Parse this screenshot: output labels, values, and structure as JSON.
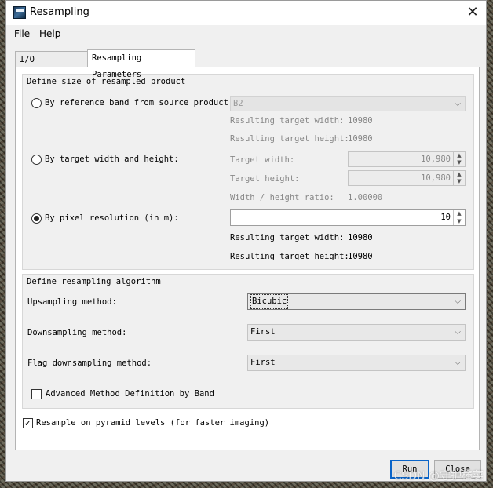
{
  "window": {
    "title": "Resampling"
  },
  "menu": [
    "File",
    "Help"
  ],
  "tabs": [
    "I/O Parameters",
    "Resampling Parameters"
  ],
  "size_group": {
    "title": "Define size of resampled product",
    "by_reference": {
      "label": "By reference band from source product:",
      "value": "B2",
      "result_width_label": "Resulting target width:",
      "result_width": "10980",
      "result_height_label": "Resulting target height:",
      "result_height": "10980"
    },
    "by_target": {
      "label": "By target width and height:",
      "width_label": "Target width:",
      "width": "10,980",
      "height_label": "Target height:",
      "height": "10,980",
      "ratio_label": "Width / height ratio:",
      "ratio": "1.00000"
    },
    "by_pixel": {
      "label": "By pixel resolution (in m):",
      "value": "10",
      "result_width_label": "Resulting target width:",
      "result_width": "10980",
      "result_height_label": "Resulting target height:",
      "result_height": "10980"
    }
  },
  "algo_group": {
    "title": "Define resampling algorithm",
    "upsampling_label": "Upsampling method:",
    "upsampling": "Bicubic",
    "downsampling_label": "Downsampling method:",
    "downsampling": "First",
    "flag_label": "Flag downsampling method:",
    "flag": "First",
    "advanced_label": "Advanced Method Definition by Band"
  },
  "pyramid_label": "Resample on pyramid levels (for faster imaging)",
  "buttons": {
    "run": "Run",
    "close": "Close"
  },
  "watermark": "CSDN @守护棒菜",
  "icons": {
    "window": "app-icon",
    "close": "close-icon",
    "dropdown": "chevron-down-icon"
  }
}
